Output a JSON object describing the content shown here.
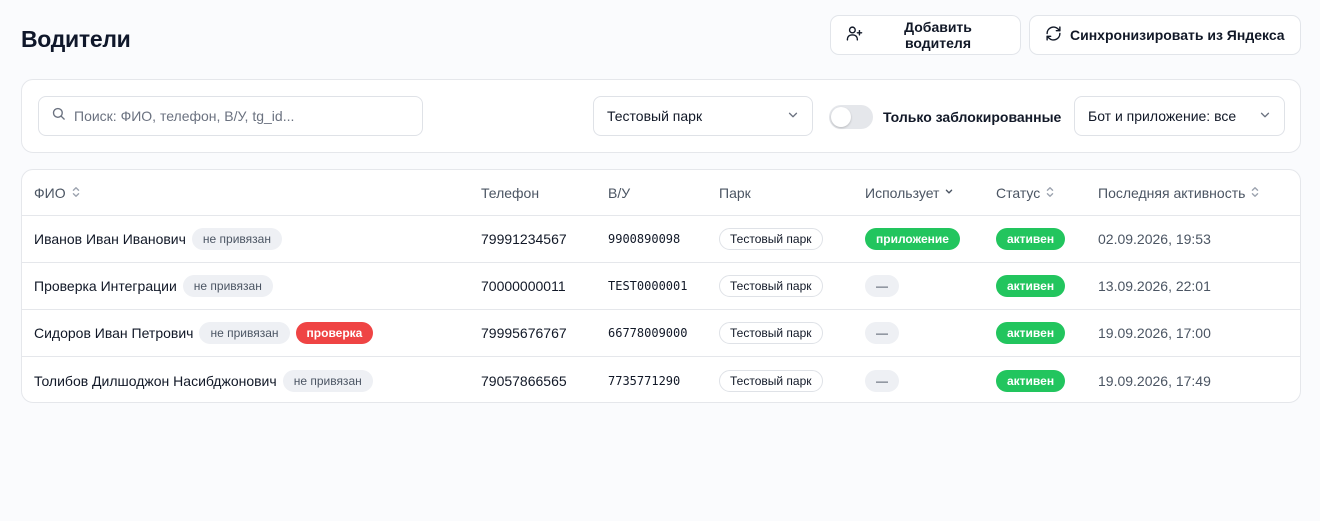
{
  "page": {
    "title": "Водители"
  },
  "actions": {
    "add_driver": "Добавить водителя",
    "sync_yandex": "Синхронизировать из Яндекса"
  },
  "filters": {
    "search_placeholder": "Поиск: ФИО, телефон, В/У, tg_id...",
    "search_value": "",
    "park_selected": "Тестовый парк",
    "blocked_only_label": "Только заблокированные",
    "blocked_only_on": false,
    "bot_app_selected": "Бот и приложение: все"
  },
  "table": {
    "columns": {
      "name": "ФИО",
      "phone": "Телефон",
      "license": "В/У",
      "park": "Парк",
      "uses": "Использует",
      "status": "Статус",
      "last_activity": "Последняя активность"
    },
    "rows": [
      {
        "name": "Иванов Иван Иванович",
        "link_badge": "не привязан",
        "extra_badge": "",
        "phone": "79991234567",
        "license": "9900890098",
        "park": "Тестовый парк",
        "uses": "приложение",
        "status": "активен",
        "last_activity": "02.09.2026, 19:53"
      },
      {
        "name": "Проверка Интеграции",
        "link_badge": "не привязан",
        "extra_badge": "",
        "phone": "70000000011",
        "license": "TEST0000001",
        "park": "Тестовый парк",
        "uses": "—",
        "status": "активен",
        "last_activity": "13.09.2026, 22:01"
      },
      {
        "name": "Сидоров Иван Петрович",
        "link_badge": "не привязан",
        "extra_badge": "проверка",
        "phone": "79995676767",
        "license": "66778009000",
        "park": "Тестовый парк",
        "uses": "—",
        "status": "активен",
        "last_activity": "19.09.2026, 17:00"
      },
      {
        "name": "Толибов Дилшоджон Насибджонович",
        "link_badge": "не привязан",
        "extra_badge": "",
        "phone": "79057866565",
        "license": "7735771290",
        "park": "Тестовый парк",
        "uses": "—",
        "status": "активен",
        "last_activity": "19.09.2026, 17:49"
      }
    ]
  },
  "icons": {
    "add_driver": "user-plus-icon",
    "sync": "refresh-icon",
    "search": "search-icon",
    "select": "chevron-down-icon",
    "sort": "sort-icon"
  },
  "colors": {
    "status_active": "#22c55e",
    "uses_app": "#22c55e",
    "check_badge": "#ef4444",
    "link_badge_bg": "#eef0f4"
  }
}
